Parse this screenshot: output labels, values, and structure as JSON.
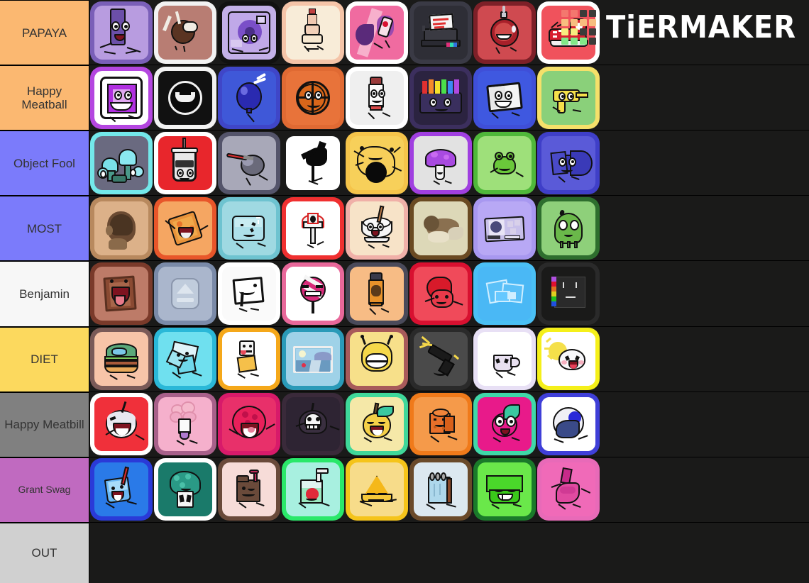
{
  "app": {
    "name": "TierMaker",
    "logo_text": "TiERMAKER",
    "background_color": "#1a1a19",
    "logo_grid_colors": [
      "#f4776e",
      "#f4776e",
      "#3b3b39",
      "#3b3b39",
      "#f7bd7f",
      "#f7bd7f",
      "#f7bd7f",
      "#f7bd7f",
      "#f7ed7f",
      "#f7ed7f",
      "#3b3b39",
      "#3b3b39",
      "#82e888",
      "#82e888",
      "#82e888",
      "#3b3b39"
    ]
  },
  "tiers": [
    {
      "label": "PAPAYA",
      "color": "#fbb871",
      "label_size": "normal",
      "items": [
        {
          "name": "purple-remote-character",
          "frame": "#7a5fb8",
          "bg": "#b89ce0",
          "art": "purple-bar"
        },
        {
          "name": "chocolate-ice-cream-character",
          "frame": "#f2f2f2",
          "bg": "#b87d73",
          "art": "chocolate-scoop"
        },
        {
          "name": "purple-fan-character",
          "frame": "#5game",
          "bg": "#c3b0e8",
          "art": "fan-square"
        },
        {
          "name": "bottle-character",
          "frame": "#f5c4a8",
          "bg": "#f8ecd8",
          "art": "bottle"
        },
        {
          "name": "pink-mouth-character",
          "frame": "#ffffff",
          "bg": "#f06ba0",
          "art": "pink-swirl"
        },
        {
          "name": "printer-character",
          "frame": "#3a3a45",
          "bg": "#2e2e36",
          "art": "printer"
        },
        {
          "name": "red-ornament-character",
          "frame": "#7d2028",
          "bg": "#cf4a50",
          "art": "ornament"
        },
        {
          "name": "red-sneaker-character",
          "frame": "#ffffff",
          "bg": "#f0525c",
          "art": "sneaker"
        }
      ]
    },
    {
      "label": "Happy Meatball",
      "color": "#fbb871",
      "label_size": "normal",
      "items": [
        {
          "name": "purple-tv-character",
          "frame": "#b446e0",
          "bg": "#ffffff",
          "art": "purple-tv"
        },
        {
          "name": "black-circle-character",
          "frame": "#f2f2f2",
          "bg": "#111111",
          "art": "black-circle"
        },
        {
          "name": "blue-balloon-character",
          "frame": "#3f46c8",
          "bg": "#3f58d8",
          "art": "blue-balloon"
        },
        {
          "name": "basketball-character",
          "frame": "#e06a33",
          "bg": "#e8733a",
          "art": "basketball"
        },
        {
          "name": "marker-character",
          "frame": "#ffffff",
          "bg": "#efefef",
          "art": "marker"
        },
        {
          "name": "rainbow-crayons-character",
          "frame": "#3c2f5e",
          "bg": "#2b2340",
          "art": "crayons"
        },
        {
          "name": "blue-book-character",
          "frame": "#3f4fd8",
          "bg": "#3f58e0",
          "art": "blue-book"
        },
        {
          "name": "yellow-gun-character",
          "frame": "#f5e06a",
          "bg": "#8ad07a",
          "art": "yellow-gun"
        }
      ]
    },
    {
      "label": "Object Fool",
      "color": "#7b7bfb",
      "label_size": "normal",
      "items": [
        {
          "name": "teal-crystal-cluster",
          "frame": "#73e8ea",
          "bg": "#6a6a80",
          "art": "crystals"
        },
        {
          "name": "soda-cup-character",
          "frame": "#ffffff",
          "bg": "#e8262c",
          "art": "soda-cup"
        },
        {
          "name": "gray-balloon-character",
          "frame": "#54546a",
          "bg": "#a8a8b8",
          "art": "gray-balloon"
        },
        {
          "name": "black-splat-character",
          "frame": "#1a1a19",
          "bg": "#ffffff",
          "art": "black-splat"
        },
        {
          "name": "yellow-scribble-character",
          "frame": "#f5c44a",
          "bg": "#f7d05a",
          "art": "yellow-scribble"
        },
        {
          "name": "purple-mushroom-character",
          "frame": "#a03fe0",
          "bg": "#e2e2e2",
          "art": "purple-mushroom"
        },
        {
          "name": "green-frog-character",
          "frame": "#4fb83a",
          "bg": "#9ee07a",
          "art": "green-frog"
        },
        {
          "name": "blue-arrow-character",
          "frame": "#3f3fc8",
          "bg": "#5a5ad8",
          "art": "blue-arrow"
        }
      ]
    },
    {
      "label": "MOST",
      "color": "#7b7bfb",
      "label_size": "normal",
      "items": [
        {
          "name": "head-photo",
          "frame": "#b8895e",
          "bg": "#dcb189",
          "art": "head-photo"
        },
        {
          "name": "orange-cracker-character",
          "frame": "#e8562a",
          "bg": "#f5a662",
          "art": "cracker"
        },
        {
          "name": "ice-cube-character",
          "frame": "#6ec3d0",
          "bg": "#9fd9e2",
          "art": "ice-cube"
        },
        {
          "name": "red-mushroom-character",
          "frame": "#f03030",
          "bg": "#ffffff",
          "art": "red-mushroom"
        },
        {
          "name": "rice-bowl-character",
          "frame": "#f0b0a8",
          "bg": "#f7e3c8",
          "art": "rice-bowl"
        },
        {
          "name": "cat-photo",
          "frame": "#6a4a22",
          "bg": "#d8d2b0",
          "art": "cat-photo"
        },
        {
          "name": "id-card-character",
          "frame": "#a898f0",
          "bg": "#b8a8f5",
          "art": "id-card"
        },
        {
          "name": "green-slime-character",
          "frame": "#2e6e2e",
          "bg": "#8ed07a",
          "art": "green-slime"
        }
      ]
    },
    {
      "label": "Benjamin",
      "color": "#f7f7f7",
      "label_size": "normal",
      "items": [
        {
          "name": "wooden-frame-character",
          "frame": "#7a3a2a",
          "bg": "#bd7b68",
          "art": "wood-frame"
        },
        {
          "name": "eject-button-character",
          "frame": "#7a8aa8",
          "bg": "#aab6cc",
          "art": "eject"
        },
        {
          "name": "white-paper-character",
          "frame": "#ffffff",
          "bg": "#fafafa",
          "art": "white-paper"
        },
        {
          "name": "pink-lollipop-character",
          "frame": "#e8689a",
          "bg": "#ffffff",
          "art": "lollipop"
        },
        {
          "name": "spray-can-character",
          "frame": "#4a4a5a",
          "bg": "#f7bc85",
          "art": "spray-can"
        },
        {
          "name": "red-blob-character",
          "frame": "#d81030",
          "bg": "#f04a5a",
          "art": "red-blob"
        },
        {
          "name": "blue-ice-character",
          "frame": "#4ac0f5",
          "bg": "#4ab8f5",
          "art": "blue-ice"
        },
        {
          "name": "pixel-art-character",
          "frame": "#2a2a2a",
          "bg": "#1a1a19",
          "art": "pixel-art"
        }
      ]
    },
    {
      "label": "DIET",
      "color": "#fcd95e",
      "label_size": "normal",
      "items": [
        {
          "name": "burger-character",
          "frame": "#7a5a58",
          "bg": "#f7c4a8",
          "art": "burger"
        },
        {
          "name": "cyan-crystal-character",
          "frame": "#2ab8d8",
          "bg": "#6fe0ef",
          "art": "cyan-crystal"
        },
        {
          "name": "dice-character",
          "frame": "#f5a81a",
          "bg": "#ffffff",
          "art": "dice"
        },
        {
          "name": "photo-frame-character",
          "frame": "#2a9ab8",
          "bg": "#9fd2e8",
          "art": "photo-frame"
        },
        {
          "name": "yellow-blob-character",
          "frame": "#a85a5a",
          "bg": "#f7e08a",
          "art": "yellow-blob"
        },
        {
          "name": "black-gun-character",
          "frame": "#2a2a2a",
          "bg": "#4a4a4a",
          "art": "black-gun"
        },
        {
          "name": "mug-character",
          "frame": "#e8e0f5",
          "bg": "#ffffff",
          "art": "mug"
        },
        {
          "name": "cloud-sun-character",
          "frame": "#f5f01a",
          "bg": "#ffffff",
          "art": "cloud-sun"
        }
      ]
    },
    {
      "label": "Happy Meatbill",
      "color": "#808080",
      "label_size": "normal",
      "items": [
        {
          "name": "red-bomb-character",
          "frame": "#ffffff",
          "bg": "#f0303a",
          "art": "red-bomb"
        },
        {
          "name": "pink-flower-character",
          "frame": "#a8608a",
          "bg": "#f5b0cc",
          "art": "pink-flower"
        },
        {
          "name": "pink-ball-character",
          "frame": "#d81a6a",
          "bg": "#e8306a",
          "art": "pink-ball"
        },
        {
          "name": "dark-skull-character",
          "frame": "#3a2a3a",
          "bg": "#2e2433",
          "art": "dark-skull"
        },
        {
          "name": "apple-character",
          "frame": "#3fd89a",
          "bg": "#f5e8a8",
          "art": "apple"
        },
        {
          "name": "orange-paper-character",
          "frame": "#f07a1a",
          "bg": "#f59a4a",
          "art": "orange-paper"
        },
        {
          "name": "magenta-berry-character",
          "frame": "#3fd8a8",
          "bg": "#e81a8a",
          "art": "magenta-berry"
        },
        {
          "name": "blue-egg-character",
          "frame": "#3f3fd8",
          "bg": "#ffffff",
          "art": "blue-egg"
        }
      ]
    },
    {
      "label": "Grant Swag",
      "color": "#c06ac0",
      "label_size": "small",
      "items": [
        {
          "name": "blue-cup-character",
          "frame": "#2a3ad8",
          "bg": "#2a7ae8",
          "art": "blue-cup"
        },
        {
          "name": "teal-bush-character",
          "frame": "#ffffff",
          "bg": "#1a7a6a",
          "art": "teal-bush"
        },
        {
          "name": "chocolate-milk-character",
          "frame": "#6a4a3a",
          "bg": "#f7dcd8",
          "art": "choco-milk"
        },
        {
          "name": "green-juice-character",
          "frame": "#2ae86a",
          "bg": "#a8f0e0",
          "art": "green-juice"
        },
        {
          "name": "yellow-pyramid-character",
          "frame": "#f5c41a",
          "bg": "#f7dc8a",
          "art": "pyramid"
        },
        {
          "name": "notebook-character",
          "frame": "#6a4a2a",
          "bg": "#dce8f0",
          "art": "notebook"
        },
        {
          "name": "green-basket-character",
          "frame": "#1a7a2a",
          "bg": "#6ae84a",
          "art": "green-basket"
        },
        {
          "name": "pink-s-character",
          "frame": "#e86ab8",
          "bg": "#f06ab8",
          "art": "pink-s"
        }
      ]
    },
    {
      "label": "OUT",
      "color": "#d0d0d0",
      "label_size": "normal",
      "items": []
    }
  ]
}
